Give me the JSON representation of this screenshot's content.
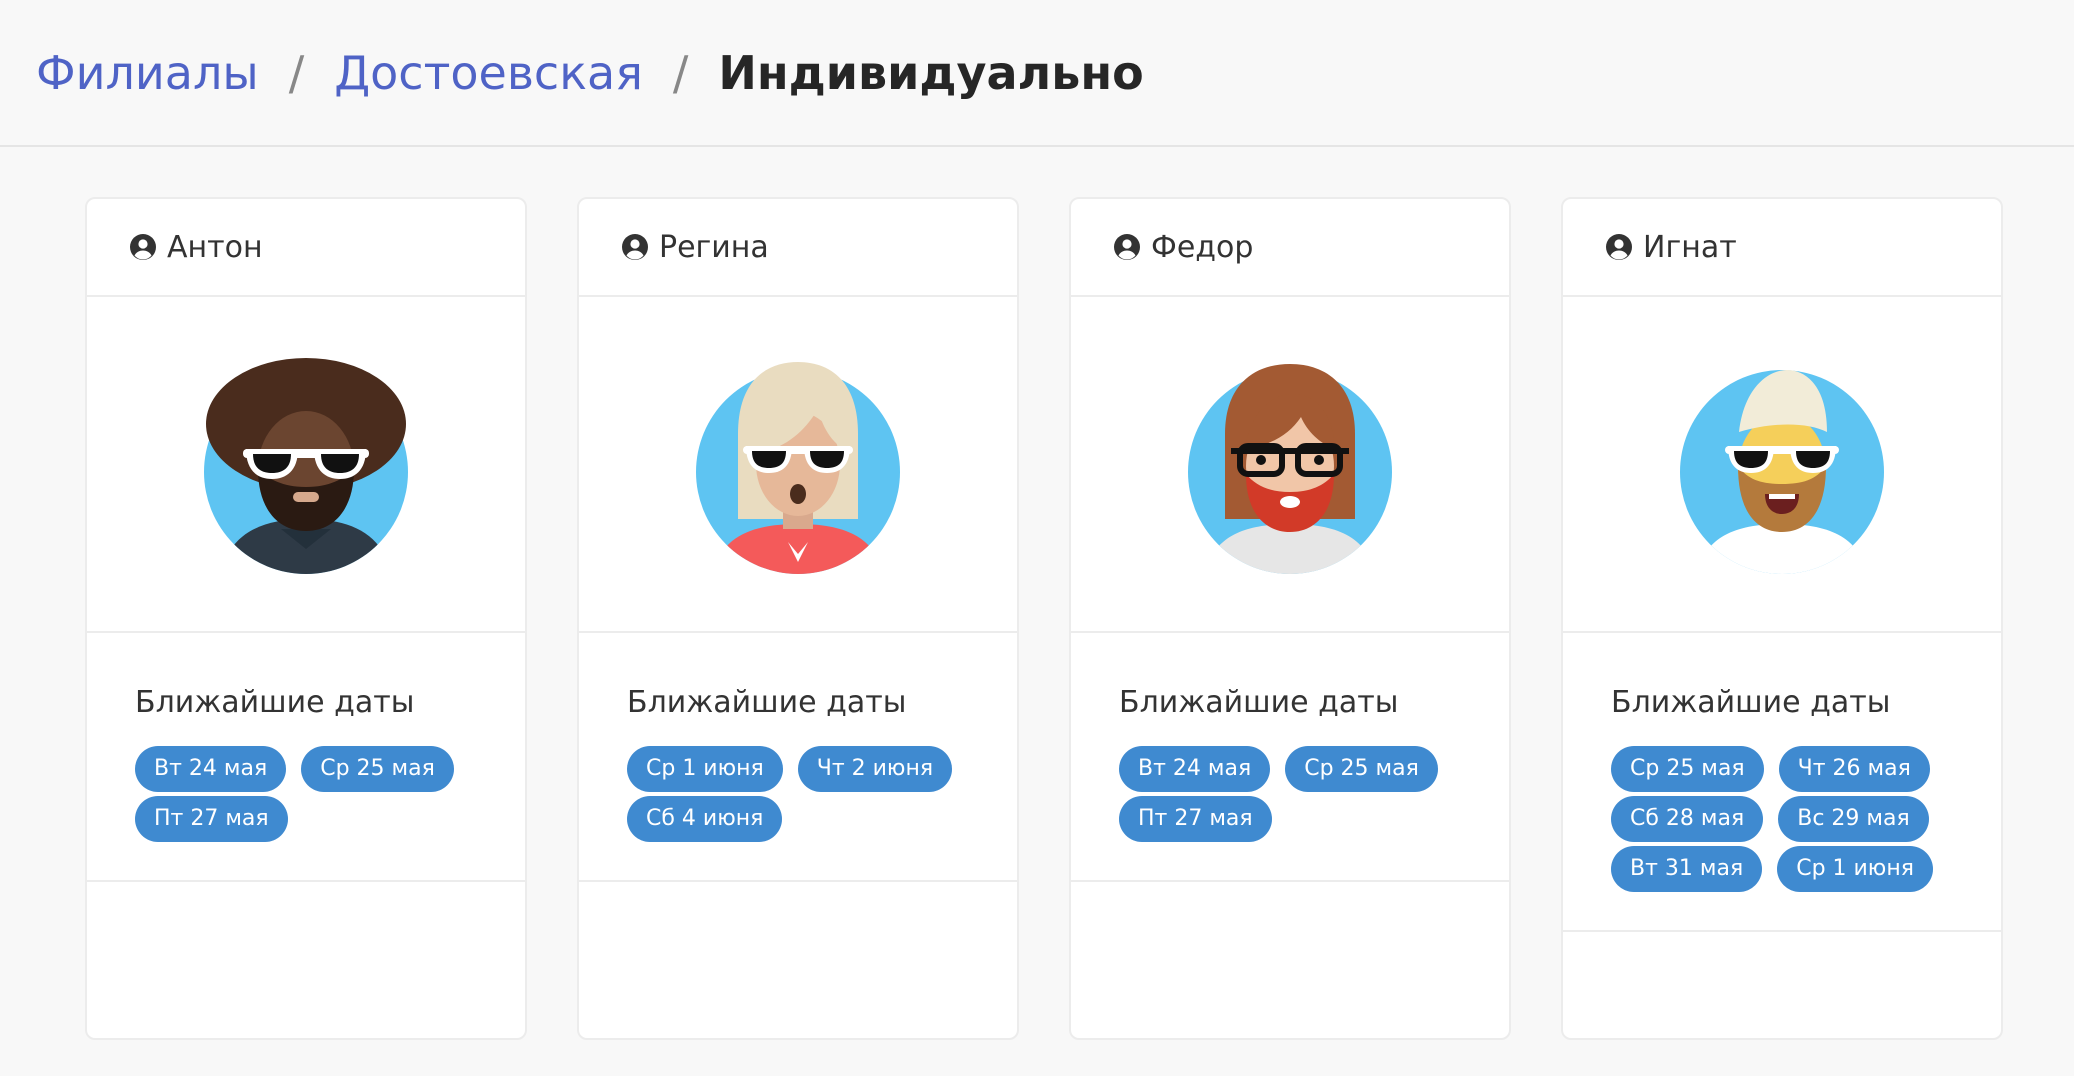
{
  "breadcrumb": {
    "items": [
      "Филиалы",
      "Достоевская"
    ],
    "separator": "/",
    "current": "Индивидуально"
  },
  "section_title": "Ближайшие даты",
  "colors": {
    "link": "#4f63c6",
    "pill": "#3f8ad0",
    "avatar_bg": "#5ec4f2"
  },
  "cards": [
    {
      "name": "Антон",
      "icon": "user-circle-icon",
      "avatar": "avatar-afro-beard-sunglasses",
      "dates": [
        "Вт 24 мая",
        "Ср 25 мая",
        "Пт 27 мая"
      ]
    },
    {
      "name": "Регина",
      "icon": "user-circle-icon",
      "avatar": "avatar-blonde-woman-sunglasses",
      "dates": [
        "Ср 1 июня",
        "Чт 2 июня",
        "Сб 4 июня"
      ]
    },
    {
      "name": "Федор",
      "icon": "user-circle-icon",
      "avatar": "avatar-redhead-beard-glasses",
      "dates": [
        "Вт 24 мая",
        "Ср 25 мая",
        "Пт 27 мая"
      ]
    },
    {
      "name": "Игнат",
      "icon": "user-circle-icon",
      "avatar": "avatar-blonde-beard-sunglasses",
      "dates": [
        "Ср 25 мая",
        "Чт 26 мая",
        "Сб 28 мая",
        "Вс 29 мая",
        "Вт 31 мая",
        "Ср 1 июня"
      ]
    }
  ]
}
